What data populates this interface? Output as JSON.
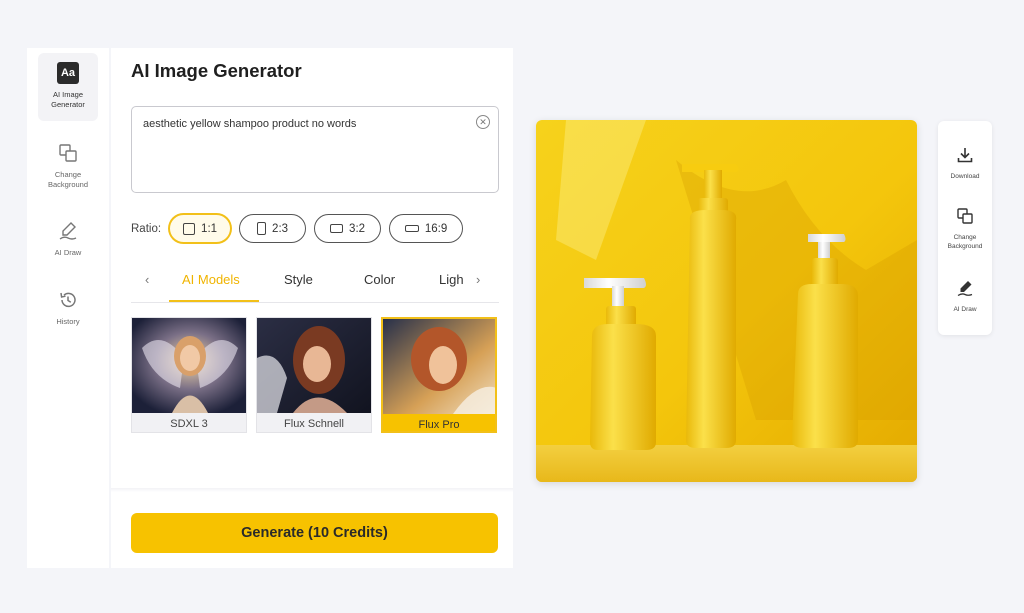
{
  "rail": {
    "items": [
      {
        "label": "AI Image Generator",
        "icon": "text-aa-icon",
        "active": true
      },
      {
        "label": "Change Background",
        "icon": "copy-squares-icon"
      },
      {
        "label": "AI Draw",
        "icon": "pen-icon"
      },
      {
        "label": "History",
        "icon": "history-icon"
      }
    ],
    "aa_glyph": "Aa"
  },
  "panel": {
    "title": "AI Image Generator",
    "prompt": {
      "value": "aesthetic yellow shampoo product no words"
    },
    "ratio_label": "Ratio:",
    "ratios": [
      {
        "label": "1:1",
        "active": true
      },
      {
        "label": "2:3"
      },
      {
        "label": "3:2"
      },
      {
        "label": "16:9"
      }
    ],
    "tabs": [
      {
        "label": "AI Models",
        "active": true
      },
      {
        "label": "Style"
      },
      {
        "label": "Color"
      },
      {
        "label": "Ligh"
      }
    ],
    "models": [
      {
        "name": "SDXL 3"
      },
      {
        "name": "Flux Schnell"
      },
      {
        "name": "Flux Pro",
        "selected": true
      }
    ],
    "generate_label": "Generate (10 Credits)"
  },
  "side_tools": [
    {
      "label": "Download",
      "icon": "download-icon"
    },
    {
      "label": "Change Background",
      "icon": "copy-squares-icon"
    },
    {
      "label": "AI Draw",
      "icon": "pen-icon"
    }
  ],
  "colors": {
    "accent": "#f7c200",
    "accent_text": "#f0b400",
    "preview_bg": "#f5c800"
  }
}
